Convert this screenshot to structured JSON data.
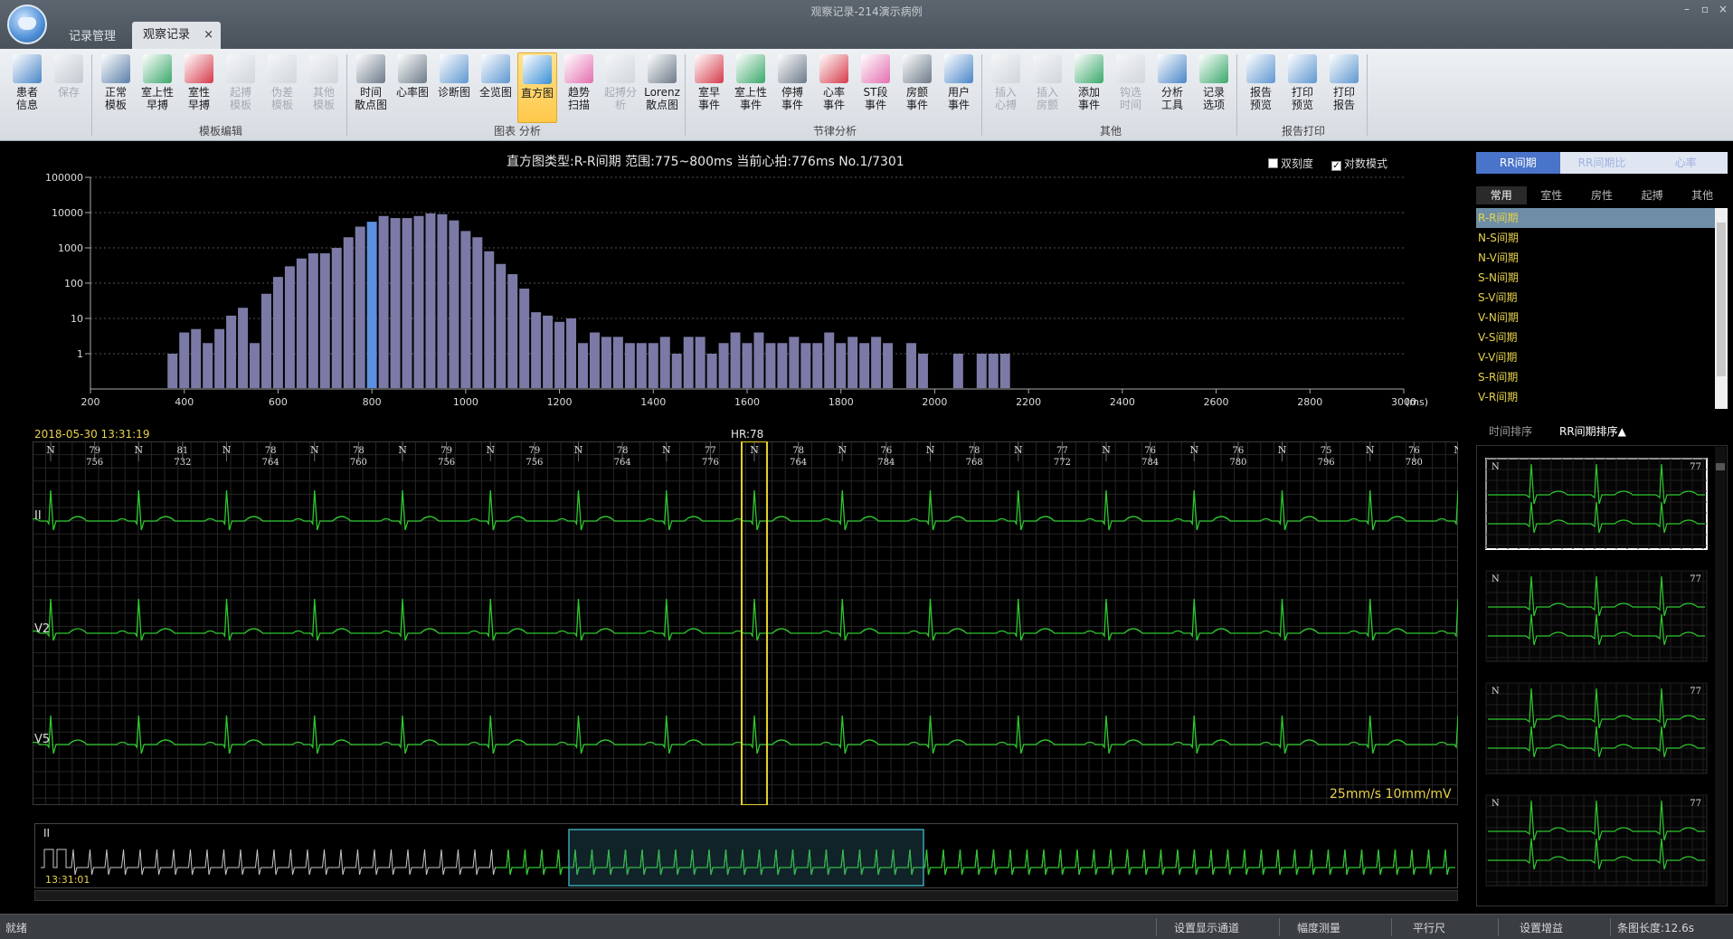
{
  "window": {
    "title": "观察记录-214演示病例",
    "tabs": [
      {
        "label": "记录管理"
      },
      {
        "label": "观察记录",
        "close": "×"
      }
    ],
    "controls": [
      "–",
      "▫",
      "×"
    ]
  },
  "ribbon": {
    "groups": [
      {
        "name": "",
        "buttons": [
          {
            "label": "患者\n信息",
            "icon": "patient-info-icon",
            "disabled": false,
            "color": "#4a86c8"
          },
          {
            "label": "保存",
            "icon": "save-icon",
            "disabled": true,
            "color": "#9aa3ad"
          }
        ]
      },
      {
        "name": "模板编辑",
        "buttons": [
          {
            "label": "正常\n模板",
            "icon": "normal-template-icon",
            "disabled": false,
            "color": "#5a7fa8"
          },
          {
            "label": "室上性\n早搏",
            "icon": "supraventricular-premature-icon",
            "disabled": false,
            "color": "#3aa86b"
          },
          {
            "label": "室性\n早搏",
            "icon": "ventricular-premature-icon",
            "disabled": false,
            "color": "#d63a4a"
          },
          {
            "label": "起搏\n模板",
            "icon": "pacing-template-icon",
            "disabled": true,
            "color": "#b9c0c7"
          },
          {
            "label": "伪差\n模板",
            "icon": "artifact-template-icon",
            "disabled": true,
            "color": "#b9c0c7"
          },
          {
            "label": "其他\n模板",
            "icon": "other-template-icon",
            "disabled": true,
            "color": "#b9c0c7"
          }
        ]
      },
      {
        "name": "图表 分析",
        "buttons": [
          {
            "label": "时间\n散点图",
            "icon": "rr-time-scatter-icon",
            "disabled": false,
            "color": "#6c7a89"
          },
          {
            "label": "心率图",
            "icon": "heart-rate-chart-icon",
            "disabled": false,
            "color": "#6c7a89"
          },
          {
            "label": "诊断图",
            "icon": "diagnosis-chart-icon",
            "disabled": false,
            "color": "#5e97d1"
          },
          {
            "label": "全览图",
            "icon": "overview-chart-icon",
            "disabled": false,
            "color": "#5e97d1"
          },
          {
            "label": "直方图",
            "icon": "histogram-icon",
            "disabled": false,
            "active": true,
            "color": "#3a8fd6"
          },
          {
            "label": "趋势\n扫描",
            "icon": "trend-scan-icon",
            "disabled": false,
            "color": "#e46fb0"
          },
          {
            "label": "起搏分析",
            "icon": "pacing-analysis-icon",
            "disabled": true,
            "color": "#b9c0c7"
          },
          {
            "label": "Lorenz\n散点图",
            "icon": "lorenz-scatter-icon",
            "disabled": false,
            "color": "#6c7a89"
          }
        ]
      },
      {
        "name": "节律分析",
        "buttons": [
          {
            "label": "室早\n事件",
            "icon": "ventricular-event-icon",
            "disabled": false,
            "color": "#d63a4a"
          },
          {
            "label": "室上性\n事件",
            "icon": "supraventricular-event-icon",
            "disabled": false,
            "color": "#3aa86b"
          },
          {
            "label": "停搏\n事件",
            "icon": "arrest-event-icon",
            "disabled": false,
            "color": "#6c7a89"
          },
          {
            "label": "心率\n事件",
            "icon": "heart-rate-event-icon",
            "disabled": false,
            "color": "#d63a4a"
          },
          {
            "label": "ST段\n事件",
            "icon": "st-segment-event-icon",
            "disabled": false,
            "color": "#e46fb0"
          },
          {
            "label": "房颤\n事件",
            "icon": "atrial-fibrillation-event-icon",
            "disabled": false,
            "color": "#6c7a89"
          },
          {
            "label": "用户\n事件",
            "icon": "user-event-icon",
            "disabled": false,
            "color": "#4a86c8"
          }
        ]
      },
      {
        "name": "其他",
        "buttons": [
          {
            "label": "插入\n心搏",
            "icon": "insert-beat-icon",
            "disabled": true,
            "color": "#b9c0c7"
          },
          {
            "label": "插入\n房颤",
            "icon": "insert-af-icon",
            "disabled": true,
            "color": "#b9c0c7"
          },
          {
            "label": "添加\n事件",
            "icon": "add-event-icon",
            "disabled": false,
            "color": "#3aa86b"
          },
          {
            "label": "钩选\n时间",
            "icon": "select-time-icon",
            "disabled": true,
            "color": "#b9c0c7"
          },
          {
            "label": "分析\n工具",
            "icon": "analysis-tools-icon",
            "disabled": false,
            "color": "#4a86c8"
          },
          {
            "label": "记录\n选项",
            "icon": "record-options-icon",
            "disabled": false,
            "color": "#3aa86b"
          }
        ]
      },
      {
        "name": "报告打印",
        "buttons": [
          {
            "label": "报告\n预览",
            "icon": "report-preview-icon",
            "disabled": false,
            "color": "#5e97d1"
          },
          {
            "label": "打印\n预览",
            "icon": "print-preview-icon",
            "disabled": false,
            "color": "#5e97d1"
          },
          {
            "label": "打印\n报告",
            "icon": "print-report-icon",
            "disabled": false,
            "color": "#5e97d1"
          }
        ]
      }
    ]
  },
  "histogram": {
    "header": "直方图类型:R-R间期   范围:775~800ms   当前心拍:776ms No.1/7301",
    "checkbox_double": "双刻度",
    "checkbox_log": "对数模式",
    "log_checked": true,
    "double_checked": false
  },
  "chart_data": {
    "type": "bar",
    "title": "",
    "xlabel": "(ms)",
    "ylabel": "",
    "x_unit": "(ms)",
    "xlim": [
      200,
      3000
    ],
    "ylim": [
      0.1,
      100000
    ],
    "y_scale": "log",
    "x_ticks": [
      "200",
      "400",
      "600",
      "800",
      "1000",
      "1200",
      "1400",
      "1600",
      "1800",
      "2000",
      "2200",
      "2400",
      "2600",
      "2800",
      "3000"
    ],
    "y_ticks": [
      "1",
      "10",
      "100",
      "1000",
      "10000",
      "100000"
    ],
    "bin_width_ms": 25,
    "selected_bin": 800,
    "bar_color": "#7b7aa6",
    "selected_color": "#5b8fe0",
    "grid": true,
    "bins": [
      [
        375,
        1
      ],
      [
        400,
        4
      ],
      [
        425,
        5
      ],
      [
        450,
        2
      ],
      [
        475,
        5
      ],
      [
        500,
        12
      ],
      [
        525,
        20
      ],
      [
        550,
        2
      ],
      [
        575,
        50
      ],
      [
        600,
        150
      ],
      [
        625,
        300
      ],
      [
        650,
        500
      ],
      [
        675,
        700
      ],
      [
        700,
        700
      ],
      [
        725,
        1000
      ],
      [
        750,
        2000
      ],
      [
        775,
        4000
      ],
      [
        800,
        5500
      ],
      [
        825,
        8000
      ],
      [
        850,
        7000
      ],
      [
        875,
        7000
      ],
      [
        900,
        8000
      ],
      [
        925,
        9500
      ],
      [
        950,
        9000
      ],
      [
        975,
        6000
      ],
      [
        1000,
        3000
      ],
      [
        1025,
        2000
      ],
      [
        1050,
        800
      ],
      [
        1075,
        350
      ],
      [
        1100,
        180
      ],
      [
        1125,
        70
      ],
      [
        1150,
        15
      ],
      [
        1175,
        12
      ],
      [
        1200,
        8
      ],
      [
        1225,
        10
      ],
      [
        1250,
        2
      ],
      [
        1275,
        4
      ],
      [
        1300,
        3
      ],
      [
        1325,
        3
      ],
      [
        1350,
        2
      ],
      [
        1375,
        2
      ],
      [
        1400,
        2
      ],
      [
        1425,
        3
      ],
      [
        1450,
        1
      ],
      [
        1475,
        3
      ],
      [
        1500,
        3
      ],
      [
        1525,
        1
      ],
      [
        1550,
        2
      ],
      [
        1575,
        4
      ],
      [
        1600,
        2
      ],
      [
        1625,
        4
      ],
      [
        1650,
        2
      ],
      [
        1675,
        2
      ],
      [
        1700,
        3
      ],
      [
        1725,
        2
      ],
      [
        1750,
        2
      ],
      [
        1775,
        4
      ],
      [
        1800,
        2
      ],
      [
        1825,
        3
      ],
      [
        1850,
        2
      ],
      [
        1875,
        3
      ],
      [
        1900,
        2
      ],
      [
        1950,
        2
      ],
      [
        1975,
        1
      ],
      [
        2050,
        1
      ],
      [
        2100,
        1
      ],
      [
        2125,
        1
      ],
      [
        2150,
        1
      ]
    ]
  },
  "ecg": {
    "datetime": "2018-05-30 13:31:19",
    "hr_label": "HR:78",
    "speed": "25mm/s 10mm/mV",
    "leads": [
      "II",
      "V2",
      "V5"
    ],
    "color": "#2ec82e",
    "highlight_color": "#e5d12a",
    "highlight_index": 16,
    "beats": [
      {
        "type": "N"
      },
      {
        "type": "N",
        "hr": "79",
        "rr": "756"
      },
      {
        "type": "N"
      },
      {
        "type": "N",
        "hr": "81",
        "rr": "732"
      },
      {
        "type": "N"
      },
      {
        "type": "N",
        "hr": "78",
        "rr": "764"
      },
      {
        "type": "N"
      },
      {
        "type": "N",
        "hr": "78",
        "rr": "760"
      },
      {
        "type": "N"
      },
      {
        "type": "N",
        "hr": "79",
        "rr": "756"
      },
      {
        "type": "N"
      },
      {
        "type": "N",
        "hr": "79",
        "rr": "756"
      },
      {
        "type": "N"
      },
      {
        "type": "N",
        "hr": "78",
        "rr": "764"
      },
      {
        "type": "N"
      },
      {
        "type": "N",
        "hr": "77",
        "rr": "776"
      },
      {
        "type": "N"
      },
      {
        "type": "N",
        "hr": "78",
        "rr": "764"
      },
      {
        "type": "N"
      },
      {
        "type": "N",
        "hr": "76",
        "rr": "784"
      },
      {
        "type": "N"
      },
      {
        "type": "N",
        "hr": "78",
        "rr": "768"
      },
      {
        "type": "N"
      },
      {
        "type": "N",
        "hr": "77",
        "rr": "772"
      },
      {
        "type": "N"
      },
      {
        "type": "N",
        "hr": "76",
        "rr": "784"
      },
      {
        "type": "N"
      },
      {
        "type": "N",
        "hr": "76",
        "rr": "780"
      },
      {
        "type": "N"
      },
      {
        "type": "N",
        "hr": "75",
        "rr": "796"
      },
      {
        "type": "N"
      },
      {
        "type": "N",
        "hr": "76",
        "rr": "780"
      },
      {
        "type": "N"
      }
    ]
  },
  "overview": {
    "lead": "II",
    "time": "13:31:01"
  },
  "right_panel": {
    "tabs": [
      {
        "label": "RR间期",
        "selected": true
      },
      {
        "label": "RR间期比",
        "selected": false
      },
      {
        "label": "心率",
        "selected": false
      }
    ],
    "subtabs": [
      {
        "label": "常用",
        "selected": true
      },
      {
        "label": "室性",
        "selected": false
      },
      {
        "label": "房性",
        "selected": false
      },
      {
        "label": "起搏",
        "selected": false
      },
      {
        "label": "其他",
        "selected": false
      }
    ],
    "items": [
      {
        "label": "R-R间期",
        "selected": true
      },
      {
        "label": "N-S间期"
      },
      {
        "label": "N-V间期"
      },
      {
        "label": "S-N间期"
      },
      {
        "label": "S-V间期"
      },
      {
        "label": "V-N间期"
      },
      {
        "label": "V-S间期"
      },
      {
        "label": "V-V间期"
      },
      {
        "label": "S-R间期"
      },
      {
        "label": "V-R间期"
      }
    ],
    "sort_time": "时间排序",
    "sort_rr": "RR间期排序▲",
    "beat_thumbs": [
      {
        "type": "N",
        "hr": "77",
        "selected": true
      },
      {
        "type": "N",
        "hr": "77"
      },
      {
        "type": "N",
        "hr": "77"
      },
      {
        "type": "N",
        "hr": "77"
      }
    ]
  },
  "status": {
    "ready": "就绪",
    "set_channel": "设置显示通道",
    "amplitude": "幅度测量",
    "parallel_ruler": "平行尺",
    "set_gain": "设置增益",
    "strip_length": "条图长度:12.6s"
  }
}
